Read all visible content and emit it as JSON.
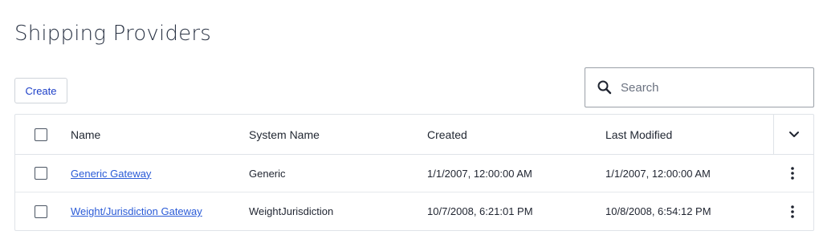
{
  "page": {
    "title": "Shipping Providers"
  },
  "toolbar": {
    "create_label": "Create"
  },
  "search": {
    "placeholder": "Search",
    "value": ""
  },
  "table": {
    "columns": [
      "Name",
      "System Name",
      "Created",
      "Last Modified"
    ],
    "rows": [
      {
        "name": "Generic Gateway",
        "system_name": "Generic",
        "created": "1/1/2007, 12:00:00 AM",
        "last_modified": "1/1/2007, 12:00:00 AM"
      },
      {
        "name": "Weight/Jurisdiction Gateway",
        "system_name": "WeightJurisdiction",
        "created": "10/7/2008, 6:21:01 PM",
        "last_modified": "10/8/2008, 6:54:12 PM"
      }
    ]
  },
  "icons": {
    "search": "search-icon",
    "column_toggle": "chevron-down-icon",
    "row_actions": "kebab-menu-icon"
  },
  "colors": {
    "link": "#2a5bd7",
    "button_text": "#1e40c8",
    "border": "#dfe3e8"
  }
}
